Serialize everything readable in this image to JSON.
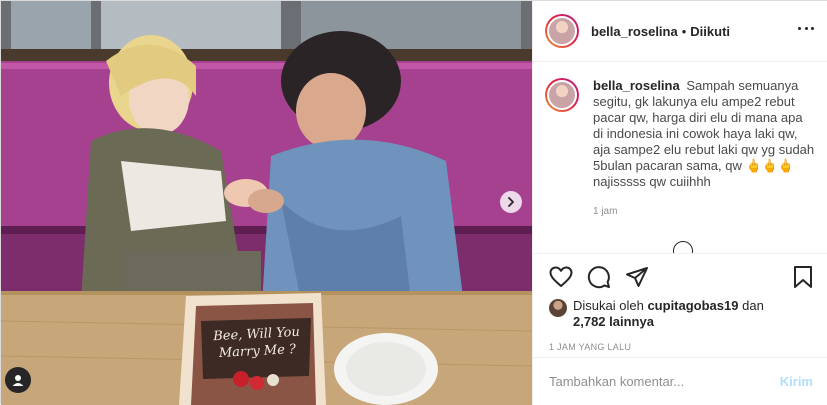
{
  "post": {
    "username": "bella_roselina",
    "separator": "•",
    "follow_state": "Diikuti",
    "caption": {
      "username": "bella_roselina",
      "text": "Sampah semuanya segitu, gk lakunya elu ampe2 rebut pacar qw, harga diri elu di mana apa di indonesia ini cowok haya laki qw, aja sampe2 elu rebut laki qw yg sudah 5bulan pacaran sama, qw 🖕🖕🖕 najisssss qw cuiihhh",
      "time": "1 jam"
    },
    "likes": {
      "prefix": "Disukai oleh",
      "user": "cupitagobas19",
      "joiner": "dan",
      "count": "2,782 lainnya"
    },
    "timestamp": "1 JAM YANG LALU",
    "comment_input": {
      "placeholder": "Tambahkan komentar...",
      "value": ""
    },
    "post_button": "Kirim"
  },
  "photo": {
    "cake_text": "Bee, Will You\nMarry Me ?"
  },
  "icons": {
    "like": "heart-icon",
    "comment": "comment-icon",
    "share": "paper-plane-icon",
    "save": "bookmark-icon",
    "more": "more-options-icon",
    "next": "chevron-right-icon",
    "tag": "user-tag-icon"
  },
  "colors": {
    "post_button": "#b2dffc",
    "secondary_text": "#8e8e8e",
    "border": "#dbdbdb"
  }
}
